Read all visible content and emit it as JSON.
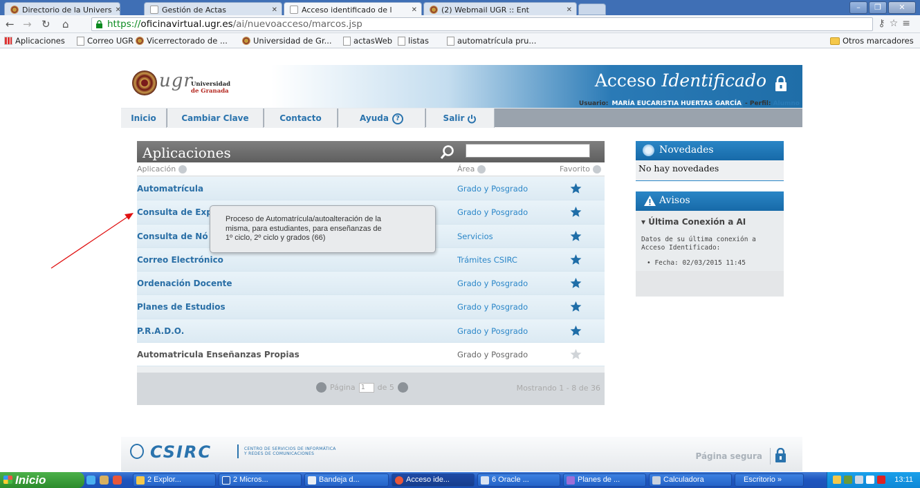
{
  "browser": {
    "tabs": [
      {
        "label": "Directorio de la Univers",
        "icon": "ugr-seal-icon"
      },
      {
        "label": "Gestión de Actas",
        "icon": "page-icon"
      },
      {
        "label": "Acceso identificado de l",
        "icon": "page-icon",
        "active": true
      },
      {
        "label": "(2) Webmail UGR :: Ent",
        "icon": "ugr-seal-icon"
      }
    ],
    "url": {
      "scheme": "https://",
      "host": "oficinavirtual.ugr.es",
      "path": "/ai/nuevoacceso/marcos.jsp"
    },
    "bookmarks": [
      {
        "label": "Aplicaciones",
        "icon": "apps-grid-icon"
      },
      {
        "label": "Correo UGR",
        "icon": "page-icon"
      },
      {
        "label": "Vicerrectorado de ...",
        "icon": "ugr-seal-icon"
      },
      {
        "label": "Universidad de Gr...",
        "icon": "ugr-seal-icon"
      },
      {
        "label": "actasWeb",
        "icon": "page-icon"
      },
      {
        "label": "listas",
        "icon": "page-icon"
      },
      {
        "label": "automatrícula pru...",
        "icon": "page-icon"
      }
    ],
    "other_bookmarks": "Otros marcadores"
  },
  "site": {
    "logo_text": "ugr",
    "logo_univ_1": "Universidad",
    "logo_univ_2": "de Granada",
    "title_plain": "Acceso ",
    "title_italic": "Identificado",
    "user_prefix": "Usuario: ",
    "user_name": "MARÍA EUCARISTIA HUERTAS GARCÍA",
    "profile_prefix": " - Perfil: ",
    "profile": "Alumno"
  },
  "menu": {
    "inicio": "Inicio",
    "cambiar_clave": "Cambiar Clave",
    "contacto": "Contacto",
    "ayuda": "Ayuda",
    "salir": "Salir"
  },
  "apps": {
    "title": "Aplicaciones",
    "col_app": "Aplicación",
    "col_area": "Área",
    "col_fav": "Favorito",
    "rows": [
      {
        "name": "Automatrícula",
        "area": "Grado y Posgrado",
        "favorite": true
      },
      {
        "name": "Consulta de Exp",
        "area": "Grado y Posgrado",
        "favorite": true
      },
      {
        "name": "Consulta de Nó",
        "area": "Servicios",
        "favorite": true
      },
      {
        "name": "Correo Electrónico",
        "area": "Trámites CSIRC",
        "favorite": true
      },
      {
        "name": "Ordenación Docente",
        "area": "Grado y Posgrado",
        "favorite": true
      },
      {
        "name": "Planes de Estudios",
        "area": "Grado y Posgrado",
        "favorite": true
      },
      {
        "name": "P.R.A.D.O.",
        "area": "Grado y Posgrado",
        "favorite": true
      },
      {
        "name": "Automatricula Enseñanzas Propias",
        "area": "Grado y Posgrado",
        "favorite": false
      }
    ],
    "pager_label": "Página",
    "pager_page": "1",
    "pager_of": "de 5",
    "showing": "Mostrando 1 - 8 de 36"
  },
  "tooltip": {
    "line1": "Proceso de Automatrícula/autoalteración de la",
    "line2": "misma, para estudiantes, para enseñanzas de",
    "line3": "1º ciclo, 2º ciclo y grados (66)"
  },
  "news": {
    "title": "Novedades",
    "body": "No hay novedades"
  },
  "avisos": {
    "title": "Avisos",
    "subtitle": "Última Conexión a AI",
    "text": "Datos de su última conexión a Acceso Identificado:",
    "item": "Fecha: 02/03/2015 11:45"
  },
  "footer": {
    "csirc": "CSIRC",
    "csirc_line1": "CENTRO DE SERVICIOS DE INFORMÁTICA",
    "csirc_line2": "Y REDES DE COMUNICACIONES",
    "safe": "Página segura"
  },
  "taskbar": {
    "start": "Inicio",
    "tasks": [
      {
        "label": "2 Explor...",
        "icon": "folder-icon"
      },
      {
        "label": "2 Micros...",
        "icon": "word-icon"
      },
      {
        "label": "Bandeja d...",
        "icon": "mail-icon"
      },
      {
        "label": "Acceso ide...",
        "icon": "chrome-icon"
      },
      {
        "label": "6 Oracle ...",
        "icon": "oracle-icon"
      },
      {
        "label": "Planes de ...",
        "icon": "app-icon"
      },
      {
        "label": "Calculadora",
        "icon": "calculator-icon"
      }
    ],
    "escritorio": "Escritorio",
    "clock": "13:11"
  }
}
